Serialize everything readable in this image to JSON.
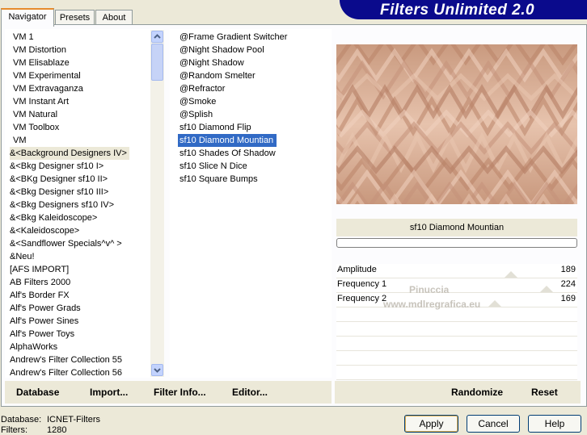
{
  "banner": {
    "title": "Filters Unlimited 2.0"
  },
  "tabs": [
    {
      "label": "Navigator"
    },
    {
      "label": "Presets"
    },
    {
      "label": "About"
    }
  ],
  "categories": [
    "VM 1",
    "VM Distortion",
    "VM Elisablaze",
    "VM Experimental",
    "VM Extravaganza",
    "VM Instant Art",
    "VM Natural",
    "VM Toolbox",
    "VM",
    "&<Background Designers IV>",
    "&<Bkg Designer sf10 I>",
    "&<BKg Designer sf10 II>",
    "&<Bkg Designer sf10 III>",
    "&<Bkg Designers sf10 IV>",
    "&<Bkg Kaleidoscope>",
    "&<Kaleidoscope>",
    "&<Sandflower Specials^v^ >",
    "&Neu!",
    "[AFS IMPORT]",
    "AB Filters 2000",
    "Alf's Border FX",
    "Alf's Power Grads",
    "Alf's Power Sines",
    "Alf's Power Toys",
    "AlphaWorks",
    "Andrew's Filter Collection 55",
    "Andrew's Filter Collection 56"
  ],
  "selected_category": "&<Background Designers IV>",
  "filters": [
    "@Frame Gradient Switcher",
    "@Night Shadow Pool",
    "@Night Shadow",
    "@Random Smelter",
    "@Refractor",
    "@Smoke",
    "@Splish",
    "sf10 Diamond Flip",
    "sf10 Diamond Mountian",
    "sf10 Shades Of Shadow",
    "sf10 Slice N Dice",
    "sf10 Square Bumps"
  ],
  "selected_filter": "sf10 Diamond Mountian",
  "preview": {
    "filter_name": "sf10 Diamond Mountian"
  },
  "params": [
    {
      "label": "Amplitude",
      "value": "189"
    },
    {
      "label": "Frequency 1",
      "value": "224"
    },
    {
      "label": "Frequency 2",
      "value": "169"
    }
  ],
  "watermark": {
    "line1": "Pinuccia",
    "line2": "www.mdlregrafica.eu"
  },
  "bottom": {
    "database": "Database",
    "import": "Import...",
    "filter_info": "Filter Info...",
    "editor": "Editor...",
    "randomize": "Randomize",
    "reset": "Reset"
  },
  "status": {
    "database_label": "Database:",
    "database_value": "ICNET-Filters",
    "filters_label": "Filters:",
    "filters_value": "1280"
  },
  "buttons": {
    "apply": "Apply",
    "cancel": "Cancel",
    "help": "Help"
  },
  "colors": {
    "banner": "#0a0a8c",
    "selection": "#316ac5",
    "preview": "#d4a98f",
    "tab_accent": "#e68b2c"
  }
}
